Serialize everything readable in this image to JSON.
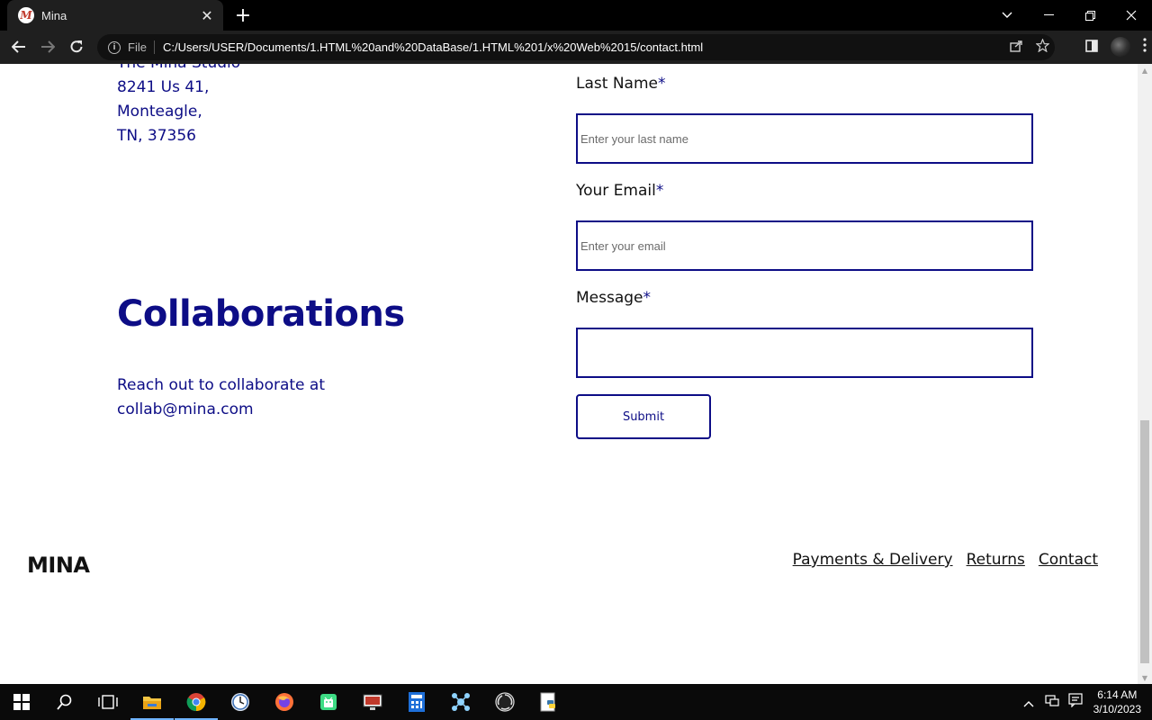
{
  "browser": {
    "tab_title": "Mina",
    "favicon_letter": "M",
    "new_tab_symbol": "+",
    "security_label": "File",
    "url": "C:/Users/USER/Documents/1.HTML%20and%20DataBase/1.HTML%201/x%20Web%2015/contact.html"
  },
  "address": {
    "lines": [
      "The Mina Studio",
      "8241 Us 41,",
      "Monteagle,",
      "TN, 37356"
    ]
  },
  "collaborations": {
    "heading": "Collaborations",
    "text_line1": "Reach out to collaborate at",
    "text_line2": "collab@mina.com"
  },
  "form": {
    "last_name_label": "Last Name",
    "last_name_placeholder": "Enter your last name",
    "email_label": "Your Email",
    "email_placeholder": "Enter your email",
    "message_label": "Message",
    "required_mark": "*",
    "submit_label": "Submit"
  },
  "footer": {
    "logo": "MINA",
    "links": [
      "Payments & Delivery",
      "Returns",
      "Contact"
    ]
  },
  "taskbar": {
    "time": "6:14 AM",
    "date": "3/10/2023",
    "icons": [
      "start-icon",
      "search-icon",
      "task-view-icon",
      "file-explorer-icon",
      "chrome-icon",
      "clock-app-icon",
      "firefox-icon",
      "android-studio-icon",
      "screen-recorder-icon",
      "calculator-icon",
      "network-app-icon",
      "obs-icon",
      "python-icon"
    ]
  },
  "colors": {
    "accent": "#0d0d86",
    "active_indicator": "#6fb3ff"
  }
}
